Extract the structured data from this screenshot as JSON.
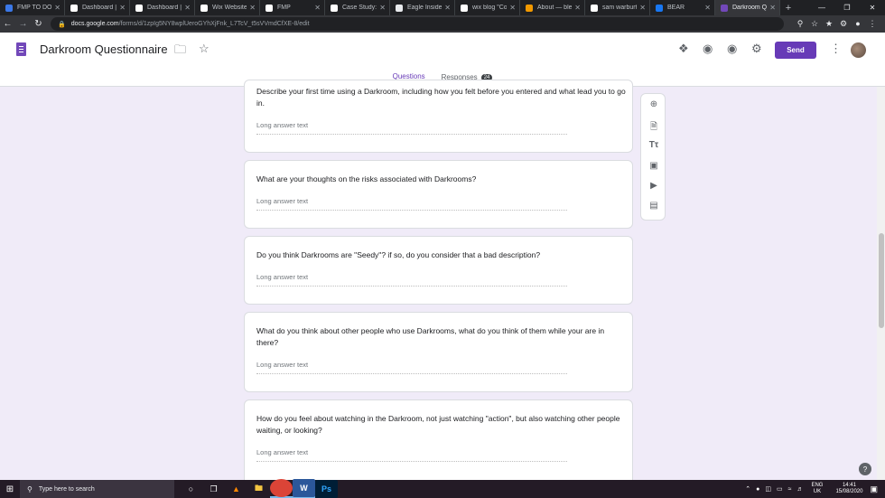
{
  "browser": {
    "tabs": [
      {
        "title": "FMP TO DO LI",
        "color": "#3b78e7"
      },
      {
        "title": "Dashboard | W",
        "color": "#ffffff"
      },
      {
        "title": "Dashboard | W",
        "color": "#ffffff"
      },
      {
        "title": "Wix Website E",
        "color": "#ffffff"
      },
      {
        "title": "FMP",
        "color": "#ffffff"
      },
      {
        "title": "Case Study: A",
        "color": "#ffffff"
      },
      {
        "title": "Eagle Inside T",
        "color": "#e8eaed"
      },
      {
        "title": "wix blog \"Com",
        "color": "#ffffff"
      },
      {
        "title": "About — blen",
        "color": "#f29900"
      },
      {
        "title": "sam warburtor",
        "color": "#ffffff"
      },
      {
        "title": "BEAR",
        "color": "#1877f2"
      },
      {
        "title": "Darkroom Qu",
        "color": "#7248b9",
        "active": true
      }
    ],
    "url_host": "docs.google.com",
    "url_path": "/forms/d/1zpIg5NY8wplUeroGYhXjFnk_L7TcV_t5sVVmdCfXE-8/edit"
  },
  "form": {
    "title": "Darkroom Questionnaire",
    "send_label": "Send",
    "tabs": {
      "questions": "Questions",
      "responses": "Responses",
      "responses_count": "24"
    },
    "questions": [
      {
        "title": "Describe your first time using a Darkroom, including how you felt before you entered and what lead you to go in.",
        "placeholder": "Long answer text"
      },
      {
        "title": "What are your thoughts on the risks associated with Darkrooms?",
        "placeholder": "Long answer text"
      },
      {
        "title": "Do you think Darkrooms are \"Seedy\"? if so, do you consider that a bad description?",
        "placeholder": "Long answer text"
      },
      {
        "title": "What do you think about other people who use Darkrooms, what do you think of them while your are in there?",
        "placeholder": "Long answer text"
      },
      {
        "title": "How do you feel about watching in the Darkroom, not just watching \"action\", but also watching other people waiting, or looking?",
        "placeholder": "Long answer text"
      }
    ],
    "help_label": "?"
  },
  "taskbar": {
    "search_placeholder": "Type here to search",
    "lang_top": "ENG",
    "lang_bottom": "UK",
    "time": "14:41",
    "date": "15/08/2020",
    "notif_count": "20"
  }
}
